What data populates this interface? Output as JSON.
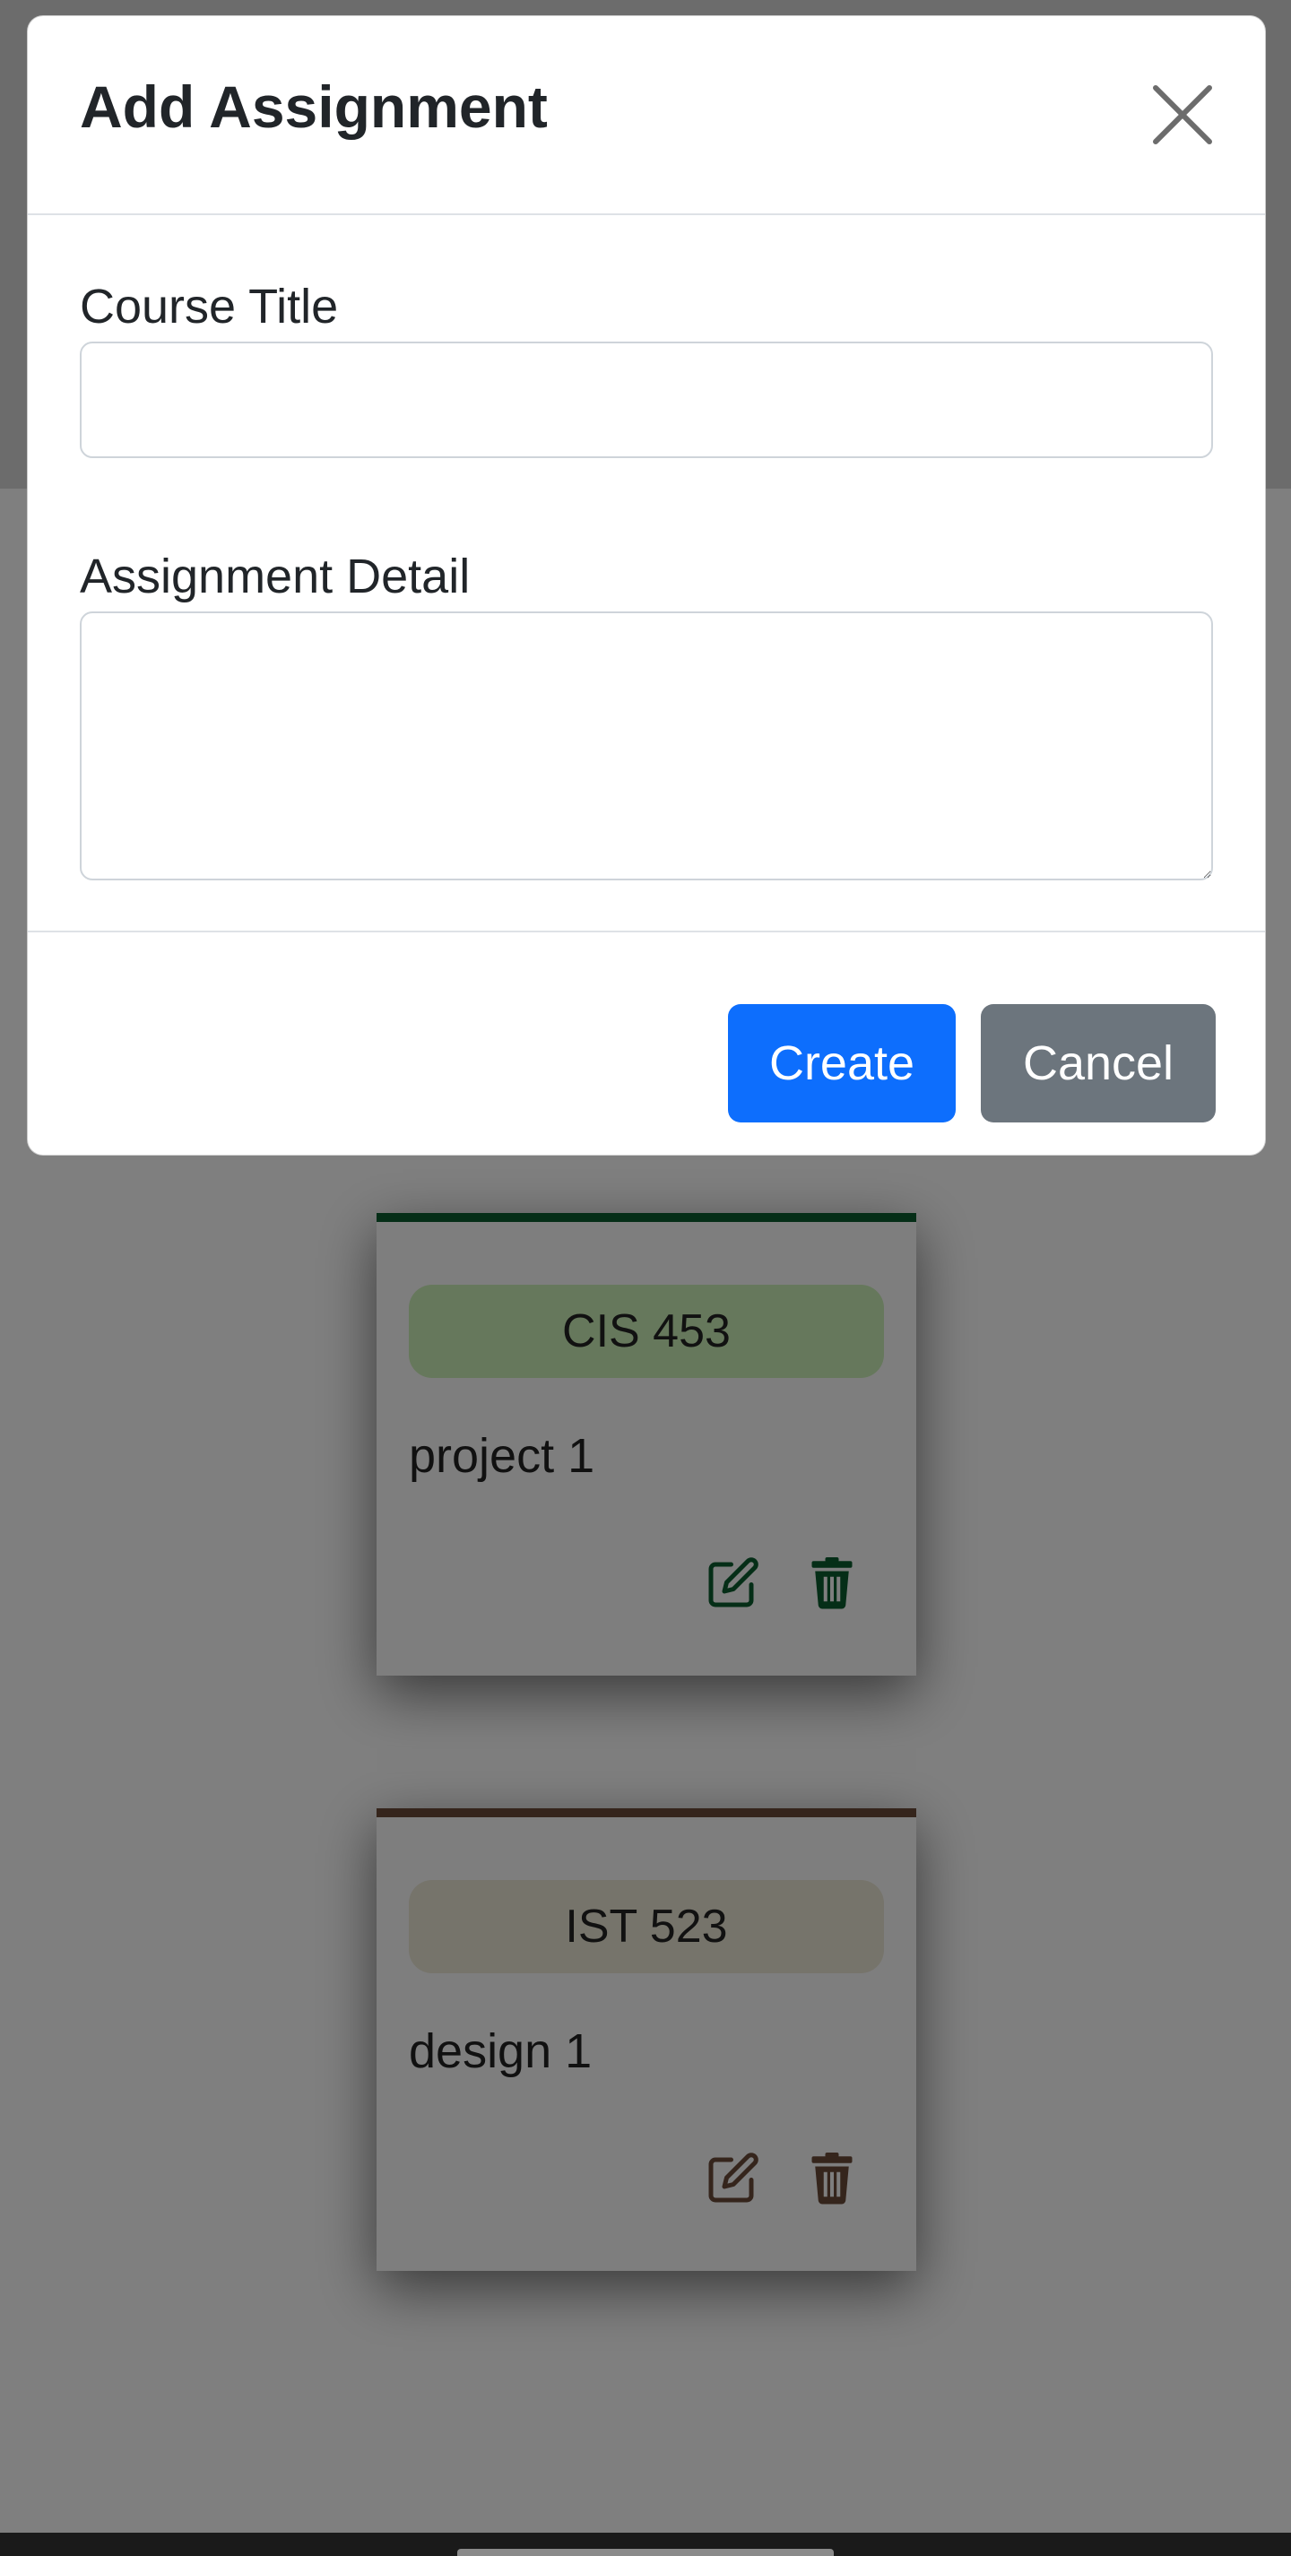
{
  "modal": {
    "title": "Add Assignment",
    "course_title_label": "Course Title",
    "course_title_value": "",
    "detail_label": "Assignment Detail",
    "detail_value": "",
    "create_label": "Create",
    "cancel_label": "Cancel"
  },
  "assignments": [
    {
      "course": "CIS 453",
      "detail": "project 1",
      "accent_color": "#0b5d2e",
      "badge_color": "#cdf0b8",
      "icons": [
        "edit-icon",
        "trash-icon"
      ]
    },
    {
      "course": "IST 523",
      "detail": "design 1",
      "accent_color": "#6b4a38",
      "badge_color": "#ece8d6",
      "icons": [
        "edit-icon",
        "trash-icon"
      ]
    }
  ],
  "colors": {
    "primary": "#0d6efd",
    "secondary": "#6c757d",
    "backdrop": "rgba(0,0,0,0.5)"
  }
}
